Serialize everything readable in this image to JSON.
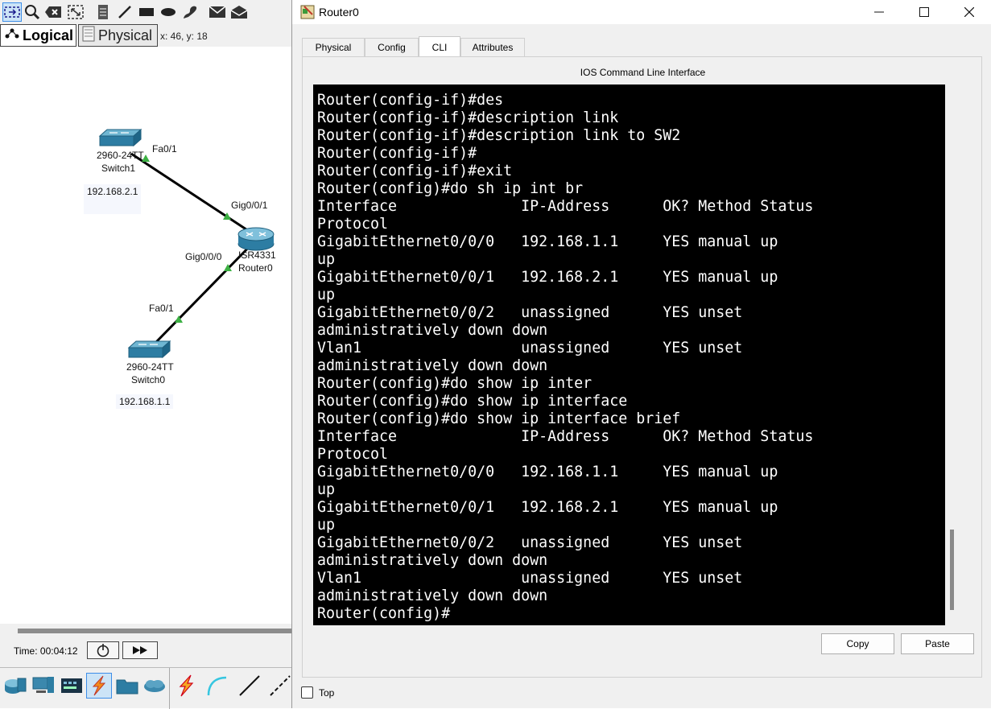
{
  "workspace": {
    "view_tabs": {
      "logical": "Logical",
      "physical": "Physical"
    },
    "coordinates": "x: 46, y: 18",
    "devices": [
      {
        "model": "2960-24TT",
        "name": "Switch1",
        "ip_note": "192.168.2.1",
        "port": "Fa0/1"
      },
      {
        "model": "ISR4331",
        "name": "Router0",
        "ports": [
          "Gig0/0/1",
          "Gig0/0/0"
        ]
      },
      {
        "model": "2960-24TT",
        "name": "Switch0",
        "ip_note": "192.168.1.1",
        "port": "Fa0/1"
      }
    ],
    "time_label": "Time: 00:04:12",
    "link_color": "#000000",
    "link_status_color": "#3cb043"
  },
  "dialog": {
    "title": "Router0",
    "tabs": [
      "Physical",
      "Config",
      "CLI",
      "Attributes"
    ],
    "active_tab": "CLI",
    "cli_title": "IOS Command Line Interface",
    "terminal_lines": [
      "Router(config-if)#des",
      "Router(config-if)#description link",
      "Router(config-if)#description link to SW2",
      "Router(config-if)#",
      "Router(config-if)#exit",
      "Router(config)#do sh ip int br",
      "Interface              IP-Address      OK? Method Status",
      "Protocol",
      "GigabitEthernet0/0/0   192.168.1.1     YES manual up",
      "up",
      "GigabitEthernet0/0/1   192.168.2.1     YES manual up",
      "up",
      "GigabitEthernet0/0/2   unassigned      YES unset",
      "administratively down down",
      "Vlan1                  unassigned      YES unset",
      "administratively down down",
      "Router(config)#do show ip inter",
      "Router(config)#do show ip interface",
      "Router(config)#do show ip interface brief",
      "Interface              IP-Address      OK? Method Status",
      "Protocol",
      "GigabitEthernet0/0/0   192.168.1.1     YES manual up",
      "up",
      "GigabitEthernet0/0/1   192.168.2.1     YES manual up",
      "up",
      "GigabitEthernet0/0/2   unassigned      YES unset",
      "administratively down down",
      "Vlan1                  unassigned      YES unset",
      "administratively down down",
      "Router(config)#"
    ],
    "copy_label": "Copy",
    "paste_label": "Paste",
    "top_label": "Top",
    "top_checked": false
  }
}
